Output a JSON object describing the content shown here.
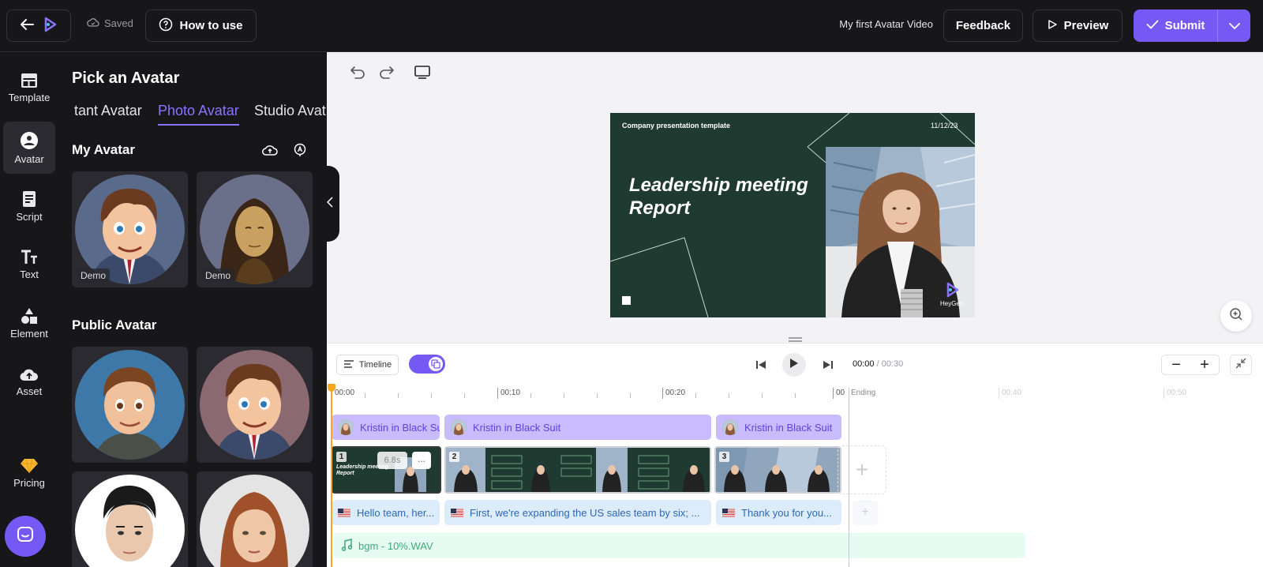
{
  "header": {
    "saved_label": "Saved",
    "how_to_use_label": "How to use",
    "project_title": "My first Avatar Video",
    "feedback_label": "Feedback",
    "preview_label": "Preview",
    "submit_label": "Submit"
  },
  "rail": {
    "items": [
      {
        "label": "Template",
        "icon": "template-icon"
      },
      {
        "label": "Avatar",
        "icon": "avatar-icon",
        "active": true
      },
      {
        "label": "Script",
        "icon": "script-icon"
      },
      {
        "label": "Text",
        "icon": "text-icon"
      },
      {
        "label": "Element",
        "icon": "element-icon"
      },
      {
        "label": "Asset",
        "icon": "asset-icon"
      },
      {
        "label": "Pricing",
        "icon": "diamond-icon"
      }
    ]
  },
  "panel": {
    "title": "Pick an Avatar",
    "tabs": [
      "tant Avatar",
      "Photo Avatar",
      "Studio Avat"
    ],
    "active_tab": "Photo Avatar",
    "my_avatar_title": "My Avatar",
    "my_avatars": [
      {
        "tag": "Demo"
      },
      {
        "tag": "Demo"
      }
    ],
    "public_avatar_title": "Public Avatar"
  },
  "slide": {
    "top_left": "Company presentation template",
    "date": "11/12/23",
    "headline_line1": "Leadership meeting",
    "headline_line2": "Report",
    "logo_text": "HeyGen"
  },
  "timeline": {
    "toggle_label": "Timeline",
    "current_time": "00:00",
    "total_time": " / 00:30",
    "ticks": [
      "00:00",
      "00:10",
      "00:20",
      "00",
      "00:40",
      "00:50"
    ],
    "ending_label": "Ending",
    "avatar_clips": [
      "Kristin in Black Suit",
      "Kristin in Black Suit",
      "Kristin in Black Suit"
    ],
    "scenes": [
      {
        "number": "1",
        "duration": "6.8s",
        "more": "..."
      },
      {
        "number": "2"
      },
      {
        "number": "3"
      }
    ],
    "scripts": [
      "Hello team, her...",
      "First, we're expanding the US sales team by six; ...",
      "Thank you for you..."
    ],
    "bgm_label": "bgm - 10%.WAV"
  },
  "colors": {
    "accent": "#7559f5",
    "dark_bg": "#17171a",
    "slide_green": "#1f3a30",
    "playhead": "#f5a623"
  }
}
